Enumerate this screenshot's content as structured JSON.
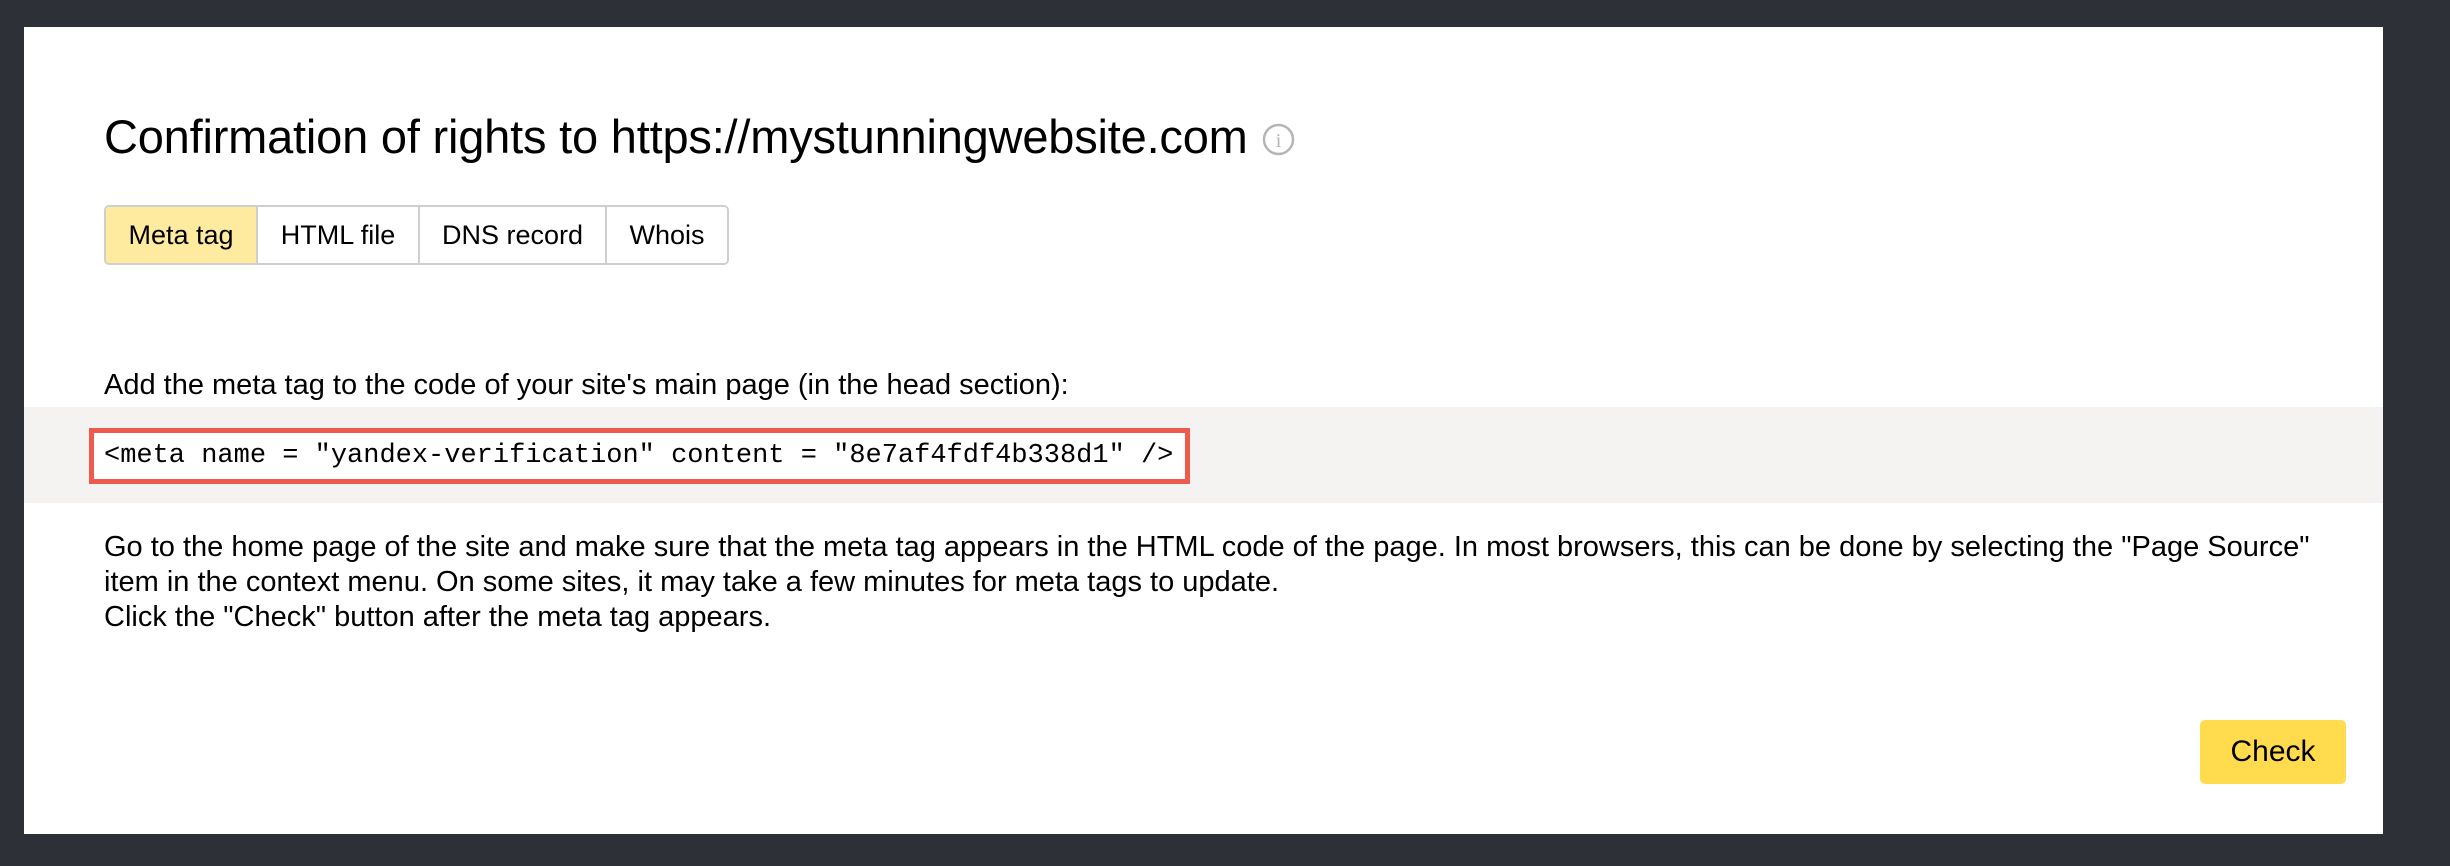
{
  "header": {
    "title": "Confirmation of rights to https://mystunningwebsite.com",
    "info_icon": "info-icon",
    "info_glyph": "i"
  },
  "tabs": [
    {
      "label": "Meta tag",
      "active": true
    },
    {
      "label": "HTML file",
      "active": false
    },
    {
      "label": "DNS record",
      "active": false
    },
    {
      "label": "Whois",
      "active": false
    }
  ],
  "main": {
    "instruction": "Add the meta tag to the code of your site's main page (in the head section):",
    "meta_tag_code": "<meta name = \"yandex-verification\" content = \"8e7af4fdf4b338d1\" />",
    "description_line1": "Go to the home page of the site and make sure that the meta tag appears in the HTML code of the page. In most browsers, this can be done by selecting the \"Page Source\" item in the context menu. On some sites, it may take a few minutes for meta tags to update.",
    "description_line2": "Click the \"Check\" button after the meta tag appears."
  },
  "actions": {
    "check_label": "Check"
  },
  "colors": {
    "frame": "#2d3137",
    "active_tab": "#ffeba0",
    "highlight_border": "#ee5a4c",
    "check_button": "#ffdb4d",
    "code_band": "#f4f3f1"
  }
}
